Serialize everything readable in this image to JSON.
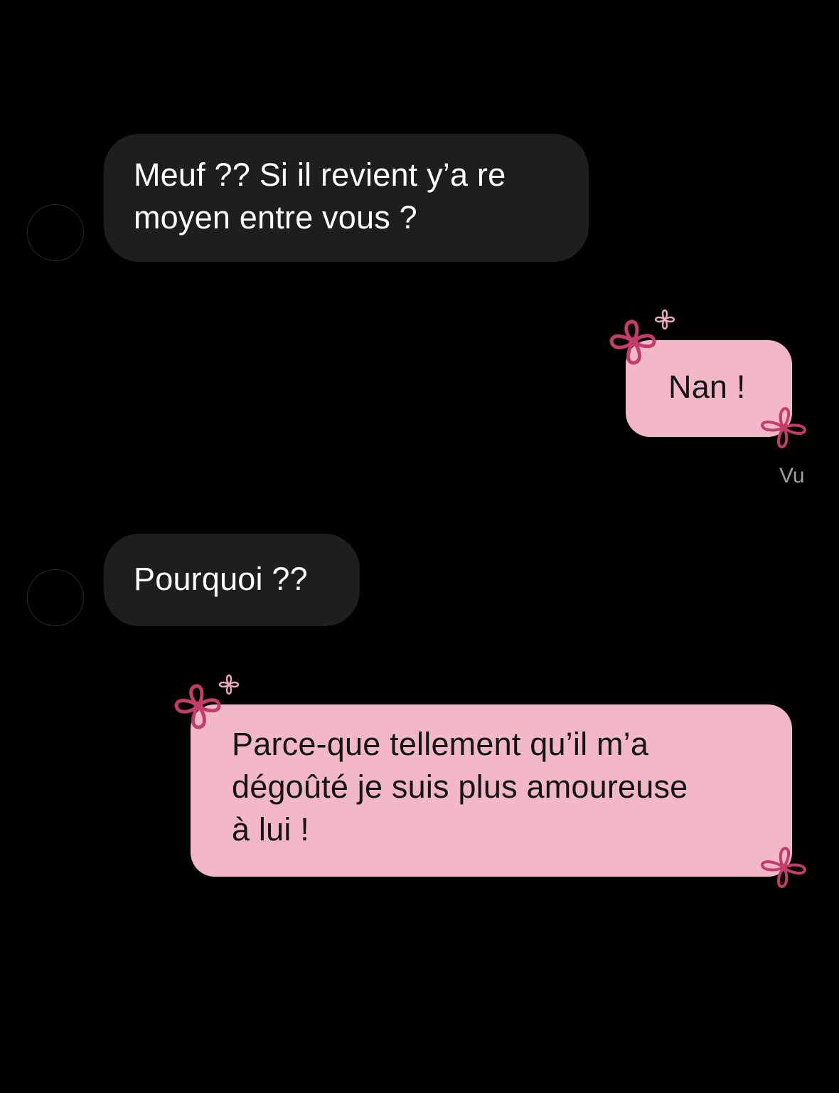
{
  "colors": {
    "background": "#000000",
    "incoming_bubble": "#1e1e1e",
    "outgoing_bubble": "#f2b8c8",
    "flower": "#c23d6c",
    "small_flower": "#e7a9bd"
  },
  "messages": [
    {
      "direction": "incoming",
      "text": "Meuf ?? Si il revient y’a re\nmoyen entre vous ?"
    },
    {
      "direction": "outgoing",
      "text": "Nan !"
    },
    {
      "direction": "incoming",
      "text": "Pourquoi ??"
    },
    {
      "direction": "outgoing",
      "text": "Parce-que tellement qu’il m’a\ndégoûté je suis plus amoureuse\nà lui !"
    }
  ],
  "status": {
    "seen_label": "Vu"
  },
  "icons": {
    "avatar": "avatar",
    "flower": "flower-icon",
    "small_flower": "small-flower-icon"
  }
}
